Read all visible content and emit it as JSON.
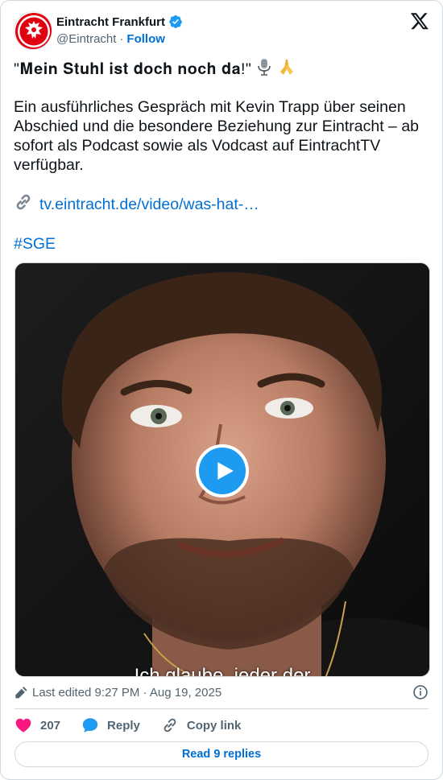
{
  "header": {
    "display_name": "Eintracht Frankfurt",
    "handle": "@Eintracht",
    "separator": "·",
    "follow_label": "Follow"
  },
  "tweet": {
    "quote_text": "\"𝐌𝐞𝐢𝐧 𝐒𝐭𝐮𝐡𝐥 𝐢𝐬𝐭 𝐝𝐨𝐜𝐡 𝐧𝐨𝐜𝐡 𝐝𝐚!\"",
    "quote_emojis": [
      "microphone-icon",
      "folded-hands-icon"
    ],
    "paragraph": "Ein ausführliches Gespräch mit Kevin Trapp über seinen Abschied und die besondere Beziehung zur Eintracht – ab sofort als Podcast sowie als Vodcast auf EintrachtTV verfügbar.",
    "link_text": "tv.eintracht.de/video/was-hat-…",
    "hashtag": "#SGE"
  },
  "media": {
    "subtitle": "Ich glaube, jeder der"
  },
  "meta": {
    "edited_text": "Last edited 9:27 PM · Aug 19, 2025"
  },
  "actions": {
    "likes": "207",
    "reply_label": "Reply",
    "copy_label": "Copy link",
    "read_replies": "Read 9 replies"
  },
  "colors": {
    "accent_blue": "#006fd6",
    "verified_blue": "#1d9bf0",
    "like_pink": "#f91880",
    "club_red": "#e1000f"
  }
}
